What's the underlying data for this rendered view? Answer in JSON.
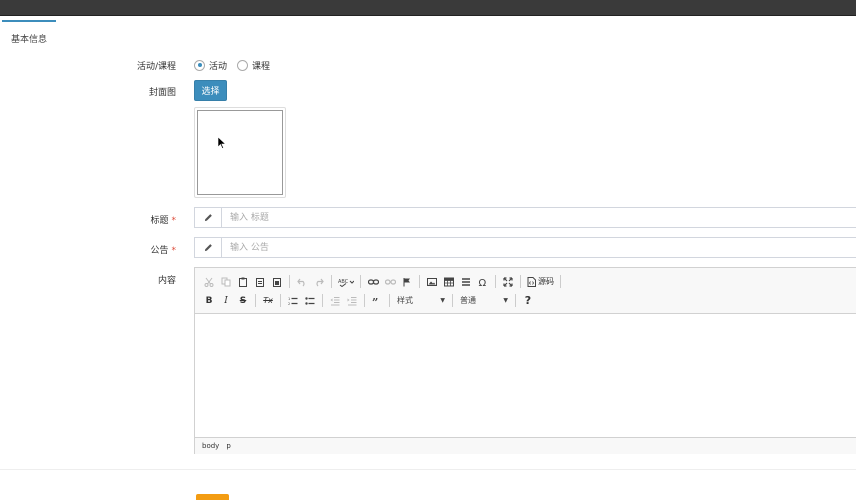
{
  "tabs": [
    {
      "label": "基本信息",
      "active": true
    }
  ],
  "form": {
    "type_label": "活动/课程",
    "type_options": [
      {
        "label": "活动",
        "checked": true
      },
      {
        "label": "课程",
        "checked": false
      }
    ],
    "cover_label": "封面图",
    "select_button": "选择",
    "title_label": "标题",
    "title_required": "*",
    "title_placeholder": "输入 标题",
    "notice_label": "公告",
    "notice_required": "*",
    "notice_placeholder": "输入 公告",
    "content_label": "内容"
  },
  "editor": {
    "toolbar_row1": [
      "cut-icon",
      "copy-icon",
      "paste-icon",
      "paste-text-icon",
      "paste-word-icon",
      "undo-icon",
      "redo-icon",
      "spellcheck-icon",
      "link-icon",
      "unlink-icon",
      "anchor-icon",
      "image-icon",
      "table-icon",
      "horizontal-rule-icon",
      "special-char-icon",
      "maximize-icon",
      "source-icon"
    ],
    "source_label": "源码",
    "bold": "B",
    "italic": "I",
    "strike": "S",
    "remove_format": "Tx",
    "style_combo": "样式",
    "format_combo": "普通",
    "help": "?",
    "path": [
      "body",
      "p"
    ]
  },
  "colors": {
    "accent": "#3c8dbc",
    "required": "#dd4b39",
    "warning": "#f39c12"
  }
}
